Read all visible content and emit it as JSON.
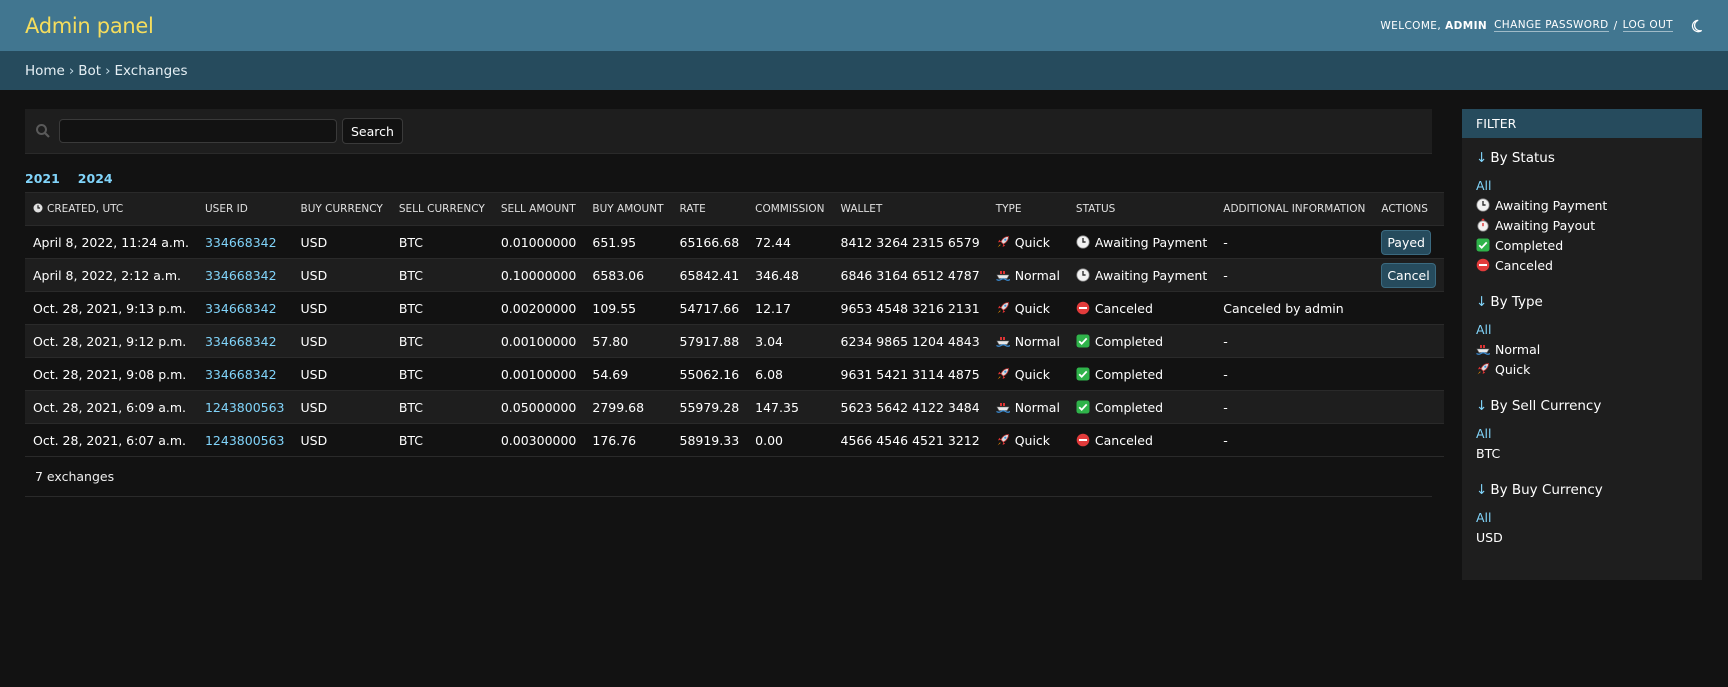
{
  "header": {
    "site_name": "Admin panel",
    "welcome": "Welcome,",
    "username": "admin",
    "change_password": "Change password",
    "separator": "/",
    "logout": "Log out"
  },
  "breadcrumbs": {
    "home": "Home",
    "app": "Bot",
    "current": "Exchanges",
    "sep": "›"
  },
  "search": {
    "button_label": "Search",
    "value": ""
  },
  "date_hierarchy": [
    "2021",
    "2024"
  ],
  "table": {
    "headers": [
      "Created, UTC",
      "User ID",
      "Buy currency",
      "Sell currency",
      "Sell amount",
      "Buy amount",
      "Rate",
      "Commission",
      "Wallet",
      "Type",
      "Status",
      "Additional information",
      "Actions"
    ],
    "rows": [
      {
        "created": "April 8, 2022, 11:24 a.m.",
        "user_id": "334668342",
        "buy_currency": "USD",
        "sell_currency": "BTC",
        "sell_amount": "0.01000000",
        "buy_amount": "651.95",
        "rate": "65166.68",
        "commission": "72.44",
        "wallet": "8412 3264 2315 6579",
        "type": "Quick",
        "type_icon": "rocket-icon",
        "status": "Awaiting Payment",
        "status_icon": "clock-icon",
        "info": "-",
        "action": "Payed"
      },
      {
        "created": "April 8, 2022, 2:12 a.m.",
        "user_id": "334668342",
        "buy_currency": "USD",
        "sell_currency": "BTC",
        "sell_amount": "0.10000000",
        "buy_amount": "6583.06",
        "rate": "65842.41",
        "commission": "346.48",
        "wallet": "6846 3164 6512 4787",
        "type": "Normal",
        "type_icon": "ship-icon",
        "status": "Awaiting Payment",
        "status_icon": "clock-icon",
        "info": "-",
        "action": "Cancel"
      },
      {
        "created": "Oct. 28, 2021, 9:13 p.m.",
        "user_id": "334668342",
        "buy_currency": "USD",
        "sell_currency": "BTC",
        "sell_amount": "0.00200000",
        "buy_amount": "109.55",
        "rate": "54717.66",
        "commission": "12.17",
        "wallet": "9653 4548 3216 2131",
        "type": "Quick",
        "type_icon": "rocket-icon",
        "status": "Canceled",
        "status_icon": "no-entry-icon",
        "info": "Canceled by admin",
        "action": ""
      },
      {
        "created": "Oct. 28, 2021, 9:12 p.m.",
        "user_id": "334668342",
        "buy_currency": "USD",
        "sell_currency": "BTC",
        "sell_amount": "0.00100000",
        "buy_amount": "57.80",
        "rate": "57917.88",
        "commission": "3.04",
        "wallet": "6234 9865 1204 4843",
        "type": "Normal",
        "type_icon": "ship-icon",
        "status": "Completed",
        "status_icon": "check-icon",
        "info": "-",
        "action": ""
      },
      {
        "created": "Oct. 28, 2021, 9:08 p.m.",
        "user_id": "334668342",
        "buy_currency": "USD",
        "sell_currency": "BTC",
        "sell_amount": "0.00100000",
        "buy_amount": "54.69",
        "rate": "55062.16",
        "commission": "6.08",
        "wallet": "9631 5421 3114 4875",
        "type": "Quick",
        "type_icon": "rocket-icon",
        "status": "Completed",
        "status_icon": "check-icon",
        "info": "-",
        "action": ""
      },
      {
        "created": "Oct. 28, 2021, 6:09 a.m.",
        "user_id": "1243800563",
        "buy_currency": "USD",
        "sell_currency": "BTC",
        "sell_amount": "0.05000000",
        "buy_amount": "2799.68",
        "rate": "55979.28",
        "commission": "147.35",
        "wallet": "5623 5642 4122 3484",
        "type": "Normal",
        "type_icon": "ship-icon",
        "status": "Completed",
        "status_icon": "check-icon",
        "info": "-",
        "action": ""
      },
      {
        "created": "Oct. 28, 2021, 6:07 a.m.",
        "user_id": "1243800563",
        "buy_currency": "USD",
        "sell_currency": "BTC",
        "sell_amount": "0.00300000",
        "buy_amount": "176.76",
        "rate": "58919.33",
        "commission": "0.00",
        "wallet": "4566 4546 4521 3212",
        "type": "Quick",
        "type_icon": "rocket-icon",
        "status": "Canceled",
        "status_icon": "no-entry-icon",
        "info": "-",
        "action": ""
      }
    ]
  },
  "paginator": "7 exchanges",
  "filter": {
    "title": "Filter",
    "groups": [
      {
        "title": "By Status",
        "items": [
          {
            "label": "All",
            "selected": true,
            "icon": ""
          },
          {
            "label": "Awaiting Payment",
            "selected": false,
            "icon": "clock-icon"
          },
          {
            "label": "Awaiting Payout",
            "selected": false,
            "icon": "stopwatch-icon"
          },
          {
            "label": "Completed",
            "selected": false,
            "icon": "check-icon"
          },
          {
            "label": "Canceled",
            "selected": false,
            "icon": "no-entry-icon"
          }
        ]
      },
      {
        "title": "By Type",
        "items": [
          {
            "label": "All",
            "selected": true,
            "icon": ""
          },
          {
            "label": "Normal",
            "selected": false,
            "icon": "ship-icon"
          },
          {
            "label": "Quick",
            "selected": false,
            "icon": "rocket-icon"
          }
        ]
      },
      {
        "title": "By Sell Currency",
        "items": [
          {
            "label": "All",
            "selected": true,
            "icon": ""
          },
          {
            "label": "BTC",
            "selected": false,
            "icon": ""
          }
        ]
      },
      {
        "title": "By Buy Currency",
        "items": [
          {
            "label": "All",
            "selected": true,
            "icon": ""
          },
          {
            "label": "USD",
            "selected": false,
            "icon": ""
          }
        ]
      }
    ]
  },
  "colors": {
    "header_bg": "#417690",
    "breadcrumb_bg": "#264b5d",
    "site_name": "#f5dd5d",
    "link": "#81d4fa",
    "body_bg": "#121212",
    "row_alt": "#1e1e1e"
  }
}
